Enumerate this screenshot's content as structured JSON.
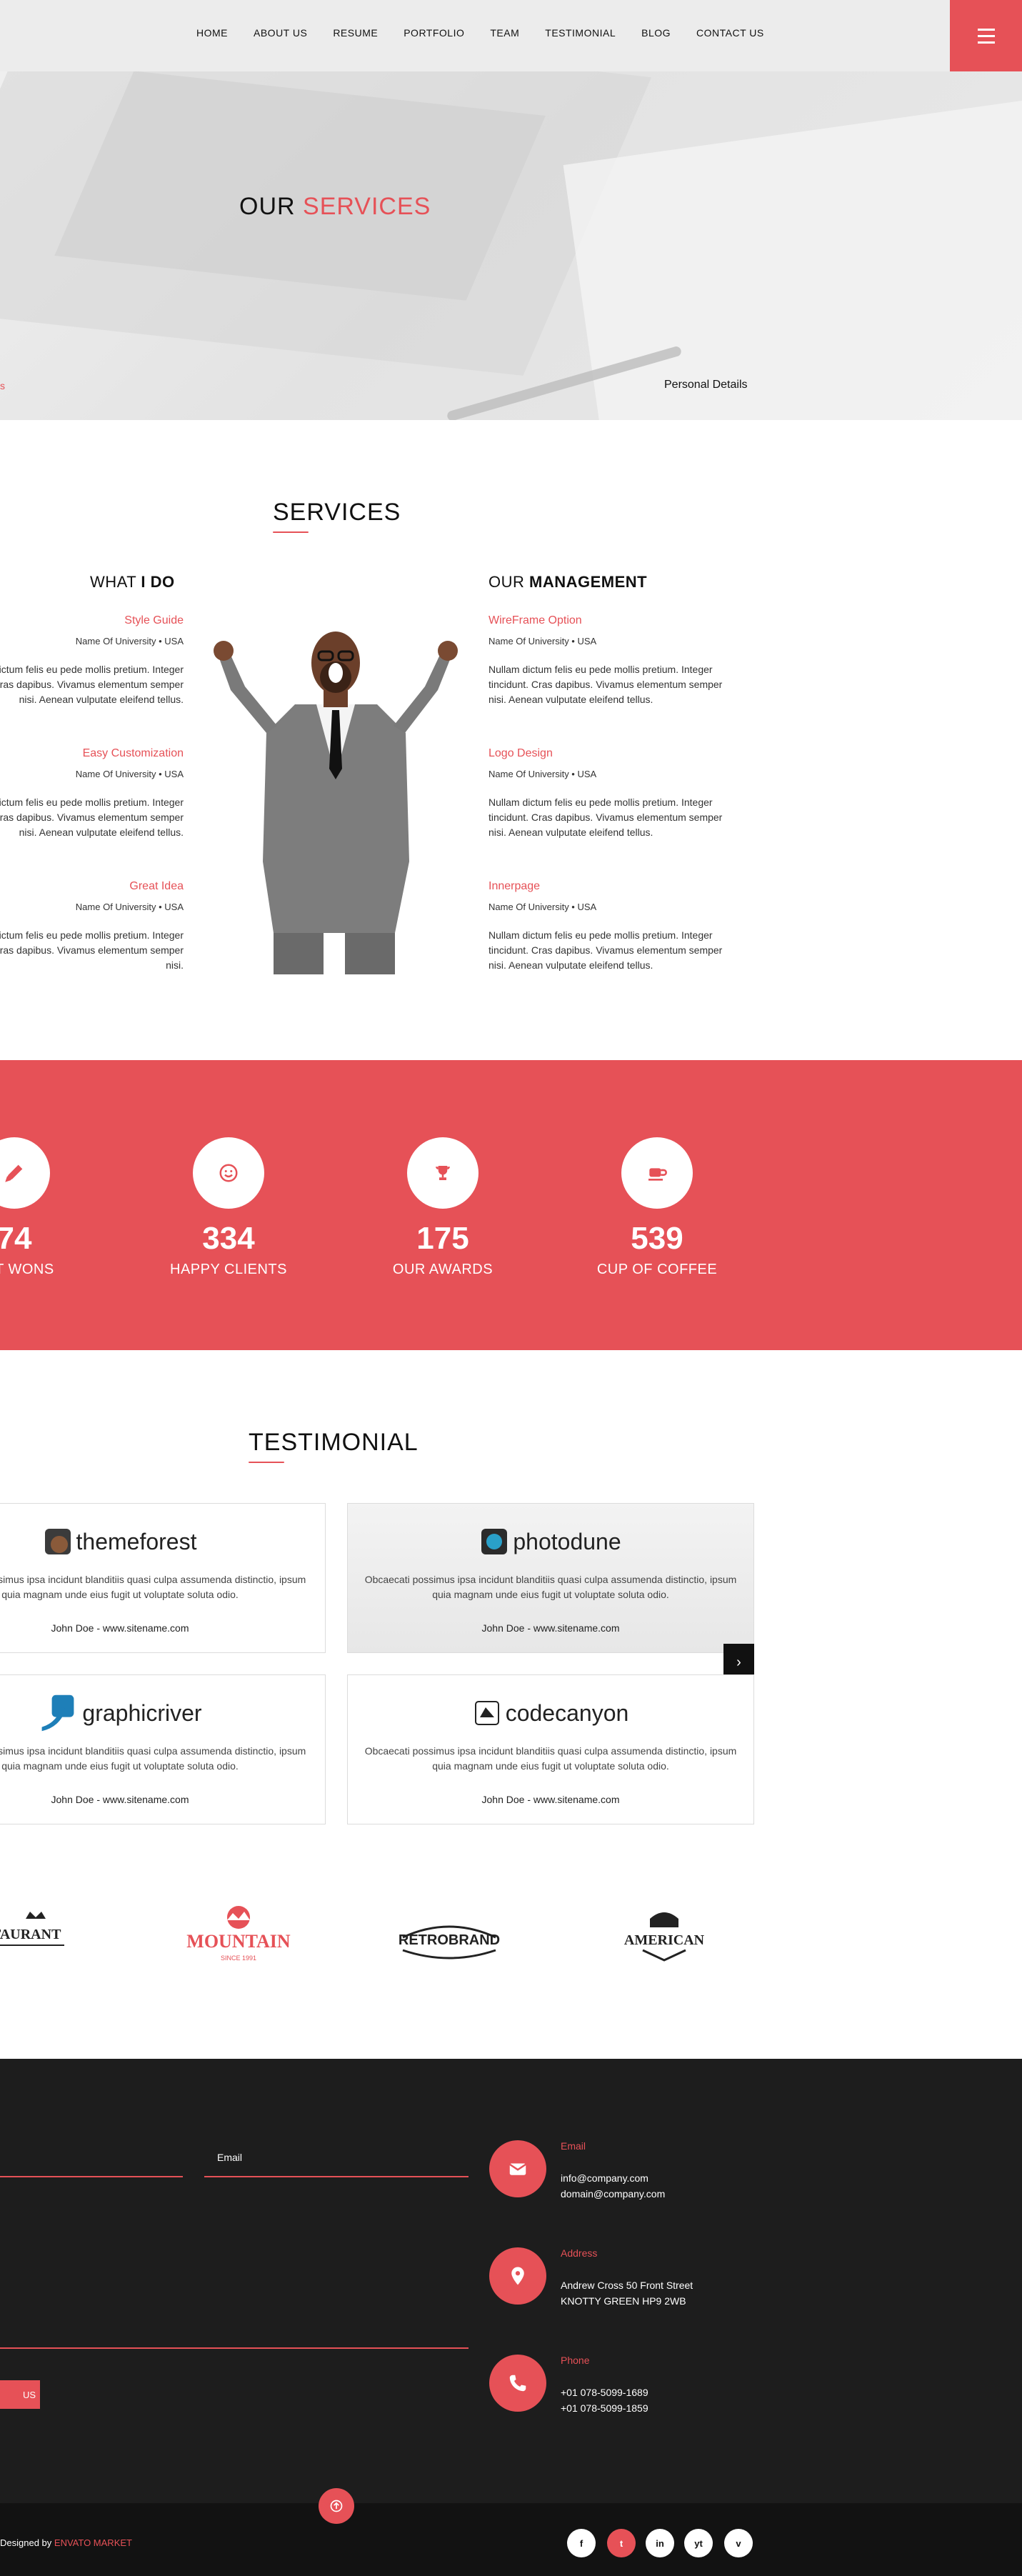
{
  "nav": {
    "items": [
      "HOME",
      "ABOUT US",
      "RESUME",
      "PORTFOLIO",
      "TEAM",
      "TESTIMONIAL",
      "BLOG",
      "CONTACT US"
    ]
  },
  "hero": {
    "title_part1": "OUR",
    "title_accent": "SERVICES",
    "crumb_left": "s",
    "crumb_right": "Personal Details"
  },
  "services": {
    "title": "SERVICES",
    "left_head_a": "WHAT",
    "left_head_b": "I DO",
    "right_head_a": "OUR",
    "right_head_b": "MANAGEMENT",
    "left": [
      {
        "title": "Style Guide",
        "sub": "Name Of University • USA",
        "desc": "Nullam dictum felis eu pede mollis pretium. Integer tincidunt. Cras dapibus. Vivamus elementum semper nisi. Aenean vulputate eleifend tellus."
      },
      {
        "title": "Easy Customization",
        "sub": "Name Of University • USA",
        "desc": "Nullam dictum felis eu pede mollis pretium. Integer tincidunt. Cras dapibus. Vivamus elementum semper nisi. Aenean vulputate eleifend tellus."
      },
      {
        "title": "Great Idea",
        "sub": "Name Of University • USA",
        "desc": "Nullam dictum felis eu pede mollis pretium. Integer tincidunt. Cras dapibus. Vivamus elementum semper nisi."
      }
    ],
    "right": [
      {
        "title": "WireFrame Option",
        "sub": "Name Of University • USA",
        "desc": "Nullam dictum felis eu pede mollis pretium. Integer tincidunt. Cras dapibus. Vivamus elementum semper nisi. Aenean vulputate eleifend tellus."
      },
      {
        "title": "Logo Design",
        "sub": "Name Of University • USA",
        "desc": "Nullam dictum felis eu pede mollis pretium. Integer tincidunt. Cras dapibus. Vivamus elementum semper nisi. Aenean vulputate eleifend tellus."
      },
      {
        "title": "Innerpage",
        "sub": "Name Of University • USA",
        "desc": "Nullam dictum felis eu pede mollis pretium. Integer tincidunt. Cras dapibus. Vivamus elementum semper nisi. Aenean vulputate eleifend tellus."
      }
    ]
  },
  "stats": [
    {
      "num": "74",
      "label": "ECT WONS",
      "icon": "pen-icon"
    },
    {
      "num": "334",
      "label": "HAPPY CLIENTS",
      "icon": "smile-icon"
    },
    {
      "num": "175",
      "label": "OUR AWARDS",
      "icon": "trophy-icon"
    },
    {
      "num": "539",
      "label": "CUP OF COFFEE",
      "icon": "coffee-icon"
    }
  ],
  "testimonial": {
    "title": "TESTIMONIAL",
    "cards": [
      {
        "brand": "themeforest",
        "text": "Obcaecati possimus ipsa incidunt blanditiis quasi culpa assumenda distinctio, ipsum quia magnam unde eius fugit ut voluptate soluta odio.",
        "by": "John Doe - www.sitename.com"
      },
      {
        "brand": "photodune",
        "text": "Obcaecati possimus ipsa incidunt blanditiis quasi culpa assumenda distinctio, ipsum quia magnam unde eius fugit ut voluptate soluta odio.",
        "by": "John Doe - www.sitename.com"
      },
      {
        "brand": "graphicriver",
        "text": "Obcaecati possimus ipsa incidunt blanditiis quasi culpa assumenda distinctio, ipsum quia magnam unde eius fugit ut voluptate soluta odio.",
        "by": "John Doe - www.sitename.com"
      },
      {
        "brand": "codecanyon",
        "text": "Obcaecati possimus ipsa incidunt blanditiis quasi culpa assumenda distinctio, ipsum quia magnam unde eius fugit ut voluptate soluta odio.",
        "by": "John Doe - www.sitename.com"
      }
    ],
    "next_label": "›"
  },
  "brands": [
    {
      "name": "TAURANT"
    },
    {
      "name": "MOUNTAIN",
      "sub": "SINCE 1991"
    },
    {
      "name": "RETROBRAND"
    },
    {
      "name": "AMERICAN"
    }
  ],
  "footer": {
    "email_label": "Email",
    "send_label": "US",
    "contact": [
      {
        "head": "Email",
        "lines": [
          "info@company.com",
          "domain@company.com"
        ],
        "icon": "envelope-icon"
      },
      {
        "head": "Address",
        "lines": [
          "Andrew Cross 50 Front Street",
          "KNOTTY GREEN HP9 2WB"
        ],
        "icon": "map-pin-icon"
      },
      {
        "head": "Phone",
        "lines": [
          "+01 078-5099-1689",
          "+01 078-5099-1859"
        ],
        "icon": "phone-icon"
      }
    ],
    "designed_by": "Designed by",
    "designed_by_brand": "ENVATO MARKET",
    "social": [
      "f",
      "t",
      "in",
      "yt",
      "v"
    ]
  },
  "colors": {
    "accent": "#e65157",
    "dark": "#1d1d1d",
    "nav_bg": "#ececec"
  }
}
